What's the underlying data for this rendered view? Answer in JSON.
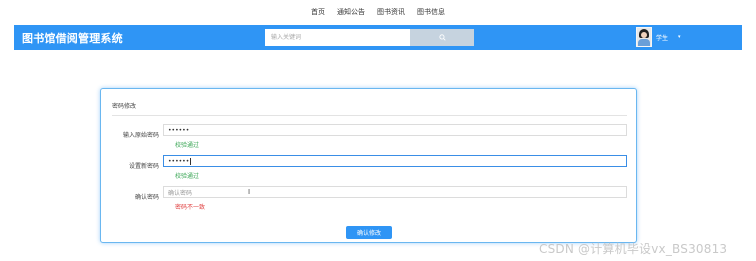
{
  "top_nav": [
    "首页",
    "通知公告",
    "图书资讯",
    "图书信息"
  ],
  "header": {
    "title": "图书馆借阅管理系统",
    "search_placeholder": "输入关键词",
    "user_name": "学生",
    "user_menu_arrow": "▾"
  },
  "form": {
    "title": "密码修改",
    "old_password": {
      "label": "输入原始密码",
      "value": "••••••",
      "message": "校验通过"
    },
    "new_password": {
      "label": "设置新密码",
      "value": "••••••",
      "message": "校验通过"
    },
    "confirm_password": {
      "label": "确认密码",
      "placeholder": "确认密码",
      "message": "密码不一致"
    },
    "submit_label": "确认修改"
  },
  "watermark": "CSDN @计算机毕设vx_BS30813",
  "colors": {
    "header_bg": "#2f95f5",
    "success": "#3aa655",
    "error": "#e04040",
    "card_border": "#6ab7f0"
  }
}
